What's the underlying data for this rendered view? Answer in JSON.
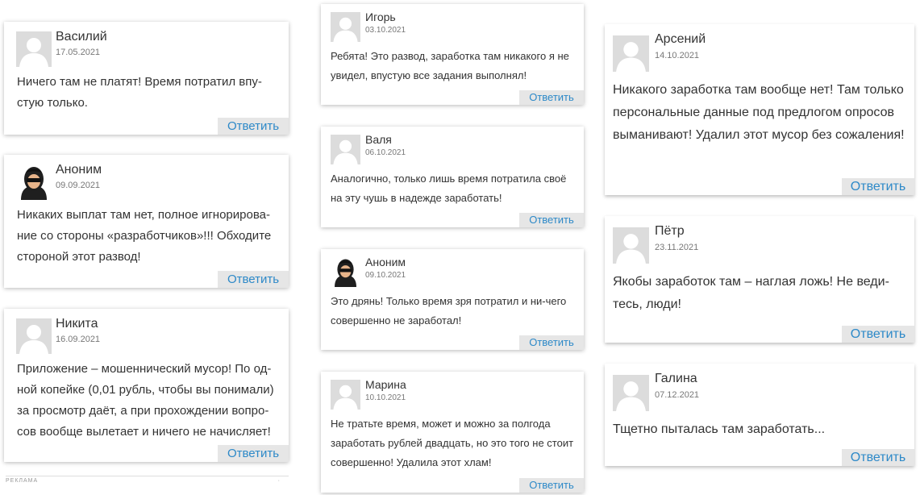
{
  "reply_label": "Ответить",
  "ad_label": "РЕКЛАМА",
  "ad_mark": "·",
  "colors": {
    "reply_text": "#2d89c8",
    "reply_bg": "#e6e6e6",
    "avatar_bg": "#dcdcdc"
  },
  "comments": [
    {
      "name": "Василий",
      "date": "17.05.2021",
      "avatar": "placeholder",
      "text": "Ничего там не платят! Время потратил впу-стую только."
    },
    {
      "name": "Аноним",
      "date": "09.09.2021",
      "avatar": "anonymous",
      "text": "Никаких выплат там нет, полное игнорирова-ние со стороны «разработчиков»!!! Обходите стороной этот развод!"
    },
    {
      "name": "Никита",
      "date": "16.09.2021",
      "avatar": "placeholder",
      "text": "Приложение – мошеннический мусор! По од-ной копейке (0,01 рубль, чтобы вы понимали) за просмотр даёт, а при прохождении вопро-сов вообще вылетает и ничего не начисляет!"
    },
    {
      "name": "Игорь",
      "date": "03.10.2021",
      "avatar": "placeholder",
      "text": "Ребята! Это развод, заработка там никакого я не увидел, впустую все задания выполнял!"
    },
    {
      "name": "Валя",
      "date": "06.10.2021",
      "avatar": "placeholder",
      "text": "Аналогично, только лишь время потратила своё на эту чушь в надежде заработать!"
    },
    {
      "name": "Аноним",
      "date": "09.10.2021",
      "avatar": "anonymous",
      "text": "Это дрянь! Только время зря потратил и ни-чего совершенно не заработал!"
    },
    {
      "name": "Марина",
      "date": "10.10.2021",
      "avatar": "placeholder",
      "text": "Не тратьте время, может и можно за полгода заработать рублей двадцать, но это того не стоит совершенно! Удалила этот хлам!"
    },
    {
      "name": "Арсений",
      "date": "14.10.2021",
      "avatar": "placeholder",
      "text": "Никакого заработка там вообще нет! Там только персональные данные под предлогом опросов выманивают! Удалил этот мусор без сожаления!"
    },
    {
      "name": "Пётр",
      "date": "23.11.2021",
      "avatar": "placeholder",
      "text": "Якобы заработок там – наглая ложь! Не веди-тесь, люди!"
    },
    {
      "name": "Галина",
      "date": "07.12.2021",
      "avatar": "placeholder",
      "text": "Тщетно пыталась там заработать..."
    }
  ]
}
